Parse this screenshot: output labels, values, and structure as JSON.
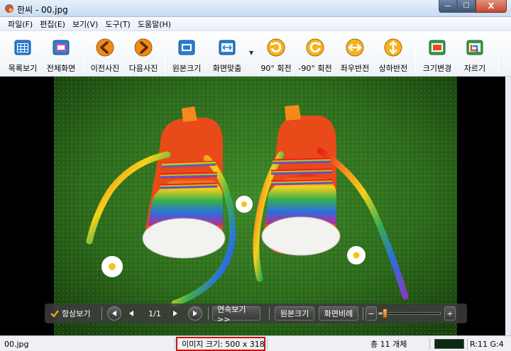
{
  "window": {
    "title": "한씨 - 00.jpg",
    "controls": {
      "minimize": "—",
      "maximize": "☐",
      "close": "X"
    }
  },
  "menu": {
    "items": [
      {
        "label": "파일(F)"
      },
      {
        "label": "편집(E)"
      },
      {
        "label": "보기(V)"
      },
      {
        "label": "도구(T)"
      },
      {
        "label": "도움말(H)"
      }
    ]
  },
  "toolbar": {
    "buttons": [
      {
        "label": "목록보기",
        "icon": "thumbnail-list-icon"
      },
      {
        "label": "전체화면",
        "icon": "fullscreen-icon"
      },
      {
        "label": "이전사진",
        "icon": "previous-arrow-icon"
      },
      {
        "label": "다음사진",
        "icon": "next-arrow-icon"
      },
      {
        "label": "원본크기",
        "icon": "original-size-icon"
      },
      {
        "label": "화면맞춤",
        "icon": "fit-screen-icon"
      },
      {
        "label": "90° 회전",
        "icon": "rotate-cw-icon"
      },
      {
        "label": "-90° 회전",
        "icon": "rotate-ccw-icon"
      },
      {
        "label": "좌우반전",
        "icon": "flip-horizontal-icon"
      },
      {
        "label": "상하반전",
        "icon": "flip-vertical-icon"
      },
      {
        "label": "크기변경",
        "icon": "resize-icon"
      },
      {
        "label": "자르기",
        "icon": "crop-icon"
      }
    ],
    "fit_dropdown_arrow": "▼"
  },
  "overlay": {
    "always_show_label": "항상보기",
    "page_indicator": "1/1",
    "slideshow_label": "연속보기 >>",
    "original_size_label": "원본크기",
    "fit_screen_label": "화면비례",
    "zoom_minus": "−",
    "zoom_plus": "+",
    "zoom_level": 0.1
  },
  "status": {
    "filename": "00.jpg",
    "image_size": "이미지 크기: 500 x 318",
    "total_count": "총 11 개체",
    "pixel_info": "R:11 G:4",
    "swatch_color": "#0b2a10"
  },
  "colors": {
    "accent_orange": "#f08a1c",
    "toolbar_blue": "#1f6fc0",
    "highlight_red": "#cc1111"
  }
}
